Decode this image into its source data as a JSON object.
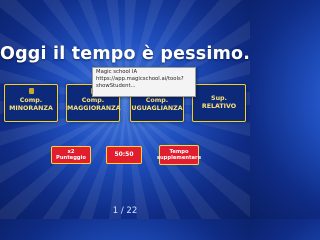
{
  "question": "Oggi il tempo è pessimo.",
  "answers": [
    {
      "label": "Comp. MINORANZA"
    },
    {
      "label": "Comp. MAGGIORANZA"
    },
    {
      "label": "Comp. UGUAGLIANZA"
    },
    {
      "label": "Sup. RELATIVO"
    }
  ],
  "powerups": [
    {
      "label": "x2 Punteggio"
    },
    {
      "label": "50:50"
    },
    {
      "label": "Tempo supplementare"
    }
  ],
  "tooltip": {
    "line1": "Magic school IA",
    "line2": "https://app.magicschool.ai/tools?",
    "line3": "showStudent..."
  },
  "pager": "1 / 22",
  "colors": {
    "answer_border": "#f2cf2a",
    "answer_text": "#fbe27a",
    "powerup_bg": "#e01e2e"
  }
}
